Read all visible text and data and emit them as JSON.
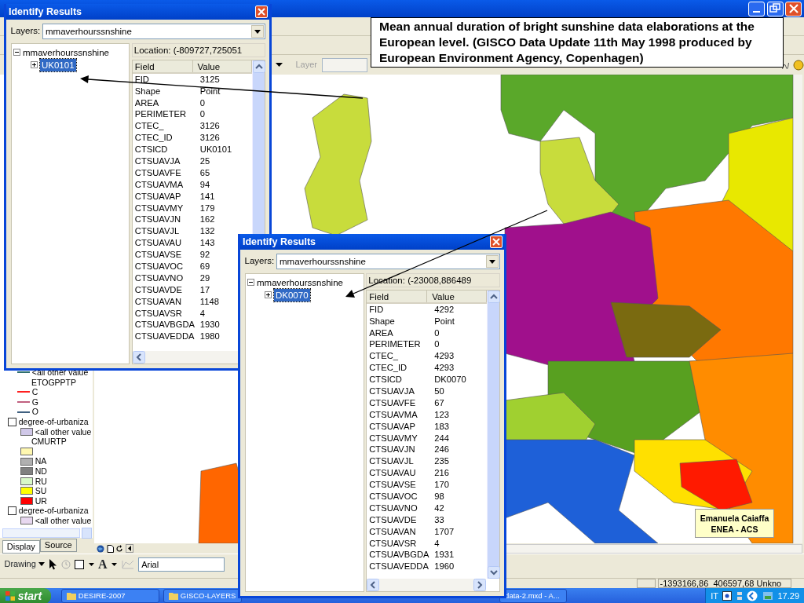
{
  "app": {
    "toolbar": {
      "layer_label": "Layer"
    },
    "toc": {
      "items": [
        {
          "kind": "line",
          "label": "<all other value",
          "color": "#2f6f6f"
        },
        {
          "kind": "heading",
          "label": "ETOGPPTP"
        },
        {
          "kind": "line",
          "label": "C",
          "color": "#ff2020"
        },
        {
          "kind": "line",
          "label": "G",
          "color": "#c06080"
        },
        {
          "kind": "line",
          "label": "O",
          "color": "#406080"
        },
        {
          "kind": "check",
          "label": "degree-of-urbaniza",
          "checked": false
        },
        {
          "kind": "swatch",
          "label": "<all other value",
          "color": "#d0c8e8"
        },
        {
          "kind": "heading",
          "label": "CMURTP"
        },
        {
          "kind": "swatch",
          "color": "#fff8b0"
        },
        {
          "kind": "swatch",
          "label": "NA",
          "color": "#b0b0b0"
        },
        {
          "kind": "swatch",
          "label": "ND",
          "color": "#808080"
        },
        {
          "kind": "swatch",
          "label": "RU",
          "color": "#d8f8c8"
        },
        {
          "kind": "swatch",
          "label": "SU",
          "color": "#ffff00"
        },
        {
          "kind": "swatch",
          "label": "UR",
          "color": "#ff0000"
        },
        {
          "kind": "check",
          "label": "degree-of-urbaniza",
          "checked": false
        },
        {
          "kind": "swatch",
          "label": "<all other value",
          "color": "#e8d8f0"
        }
      ],
      "tabs": [
        {
          "label": "Display",
          "selected": true
        },
        {
          "label": "Source",
          "selected": false
        }
      ]
    },
    "drawing_toolbar": {
      "menu": "Drawing",
      "text_tool": "A",
      "font": "Arial"
    },
    "status_bar": {
      "coordinates": "-1393166,86  406597,68 Unkno"
    }
  },
  "dialogs": [
    {
      "title": "Identify Results",
      "layers_label": "Layers:",
      "layer": "mmaverhourssnshine",
      "tree_root": "mmaverhourssnshine",
      "tree_item": {
        "label": "UK0101",
        "selected": true
      },
      "location": "Location: (-809727,725051",
      "columns": [
        "Field",
        "Value"
      ],
      "rows": [
        [
          "FID",
          "3125"
        ],
        [
          "Shape",
          "Point"
        ],
        [
          "AREA",
          "0"
        ],
        [
          "PERIMETER",
          "0"
        ],
        [
          "CTEC_",
          "3126"
        ],
        [
          "CTEC_ID",
          "3126"
        ],
        [
          "CTSICD",
          "UK0101"
        ],
        [
          "CTSUAVJA",
          "25"
        ],
        [
          "CTSUAVFE",
          "65"
        ],
        [
          "CTSUAVMA",
          "94"
        ],
        [
          "CTSUAVAP",
          "141"
        ],
        [
          "CTSUAVMY",
          "179"
        ],
        [
          "CTSUAVJN",
          "162"
        ],
        [
          "CTSUAVJL",
          "132"
        ],
        [
          "CTSUAVAU",
          "143"
        ],
        [
          "CTSUAVSE",
          "92"
        ],
        [
          "CTSUAVOC",
          "69"
        ],
        [
          "CTSUAVNO",
          "29"
        ],
        [
          "CTSUAVDE",
          "17"
        ],
        [
          "CTSUAVAN",
          "1148"
        ],
        [
          "CTSUAVSR",
          "4"
        ],
        [
          "CTSUAVBGDA",
          "1930"
        ],
        [
          "CTSUAVEDDA",
          "1980"
        ]
      ]
    },
    {
      "title": "Identify Results",
      "layers_label": "Layers:",
      "layer": "mmaverhourssnshine",
      "tree_root": "mmaverhourssnshine",
      "tree_item": {
        "label": "DK0070",
        "selected": true
      },
      "location": "Location: (-23008,886489",
      "columns": [
        "Field",
        "Value"
      ],
      "rows": [
        [
          "FID",
          "4292"
        ],
        [
          "Shape",
          "Point"
        ],
        [
          "AREA",
          "0"
        ],
        [
          "PERIMETER",
          "0"
        ],
        [
          "CTEC_",
          "4293"
        ],
        [
          "CTEC_ID",
          "4293"
        ],
        [
          "CTSICD",
          "DK0070"
        ],
        [
          "CTSUAVJA",
          "50"
        ],
        [
          "CTSUAVFE",
          "67"
        ],
        [
          "CTSUAVMA",
          "123"
        ],
        [
          "CTSUAVAP",
          "183"
        ],
        [
          "CTSUAVMY",
          "244"
        ],
        [
          "CTSUAVJN",
          "246"
        ],
        [
          "CTSUAVJL",
          "235"
        ],
        [
          "CTSUAVAU",
          "216"
        ],
        [
          "CTSUAVSE",
          "170"
        ],
        [
          "CTSUAVOC",
          "98"
        ],
        [
          "CTSUAVNO",
          "42"
        ],
        [
          "CTSUAVDE",
          "33"
        ],
        [
          "CTSUAVAN",
          "1707"
        ],
        [
          "CTSUAVSR",
          "4"
        ],
        [
          "CTSUAVBGDA",
          "1931"
        ],
        [
          "CTSUAVEDDA",
          "1960"
        ]
      ]
    }
  ],
  "annotation": "Mean annual duration of bright sunshine data elaborations at the European level. (GISCO Data Update 11th May 1998 produced by European Environment Agency, Copenhagen)",
  "credit": [
    "Emanuela Caiaffa",
    "ENEA - ACS"
  ],
  "taskbar": {
    "start": "start",
    "buttons": [
      "DESIRE-2007",
      "GISCO-LAYERS",
      "data-2.mxd - A..."
    ],
    "language": "IT",
    "clock": "17.29"
  }
}
